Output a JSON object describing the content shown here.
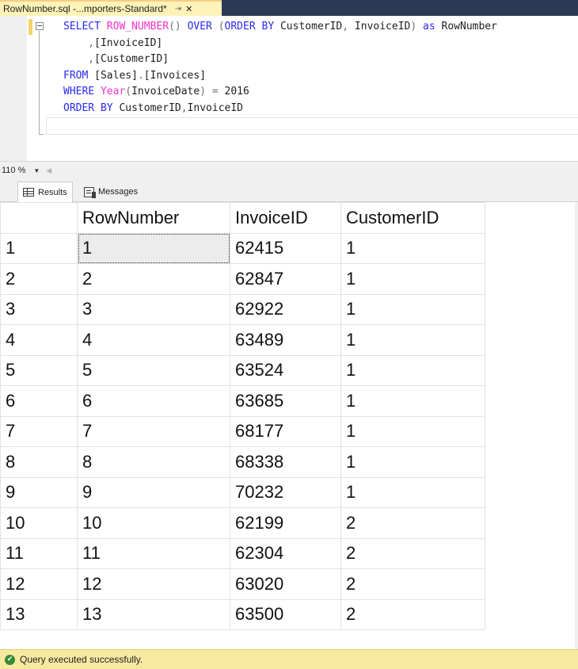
{
  "document_tab": {
    "title": "RowNumber.sql -...mporters-Standard*",
    "pin_icon": "pin-icon",
    "close_icon": "close-icon"
  },
  "editor": {
    "lines": [
      [
        [
          "kw",
          "SELECT "
        ],
        [
          "fn",
          "ROW_NUMBER"
        ],
        [
          "gr",
          "() "
        ],
        [
          "kw",
          "OVER "
        ],
        [
          "gr",
          "("
        ],
        [
          "kw",
          "ORDER BY "
        ],
        [
          "nm",
          "CustomerID"
        ],
        [
          "gr",
          ", "
        ],
        [
          "nm",
          "InvoiceID"
        ],
        [
          "gr",
          ") "
        ],
        [
          "kw",
          "as "
        ],
        [
          "nm",
          "RowNumber"
        ]
      ],
      [
        [
          "gr",
          "    ,"
        ],
        [
          "nm",
          "[InvoiceID]"
        ]
      ],
      [
        [
          "gr",
          "    ,"
        ],
        [
          "nm",
          "[CustomerID]"
        ]
      ],
      [
        [
          "kw",
          "FROM "
        ],
        [
          "nm",
          "[Sales]"
        ],
        [
          "gr",
          "."
        ],
        [
          "nm",
          "[Invoices]"
        ]
      ],
      [
        [
          "kw",
          "WHERE "
        ],
        [
          "fn",
          "Year"
        ],
        [
          "gr",
          "("
        ],
        [
          "nm",
          "InvoiceDate"
        ],
        [
          "gr",
          ") = "
        ],
        [
          "nm",
          "2016"
        ]
      ],
      [
        [
          "kw",
          "ORDER BY "
        ],
        [
          "nm",
          "CustomerID"
        ],
        [
          "gr",
          ","
        ],
        [
          "nm",
          "InvoiceID"
        ]
      ]
    ]
  },
  "zoom": {
    "value": "110 %"
  },
  "results_tabs": [
    {
      "label": "Results",
      "icon": "grid-icon",
      "active": true
    },
    {
      "label": "Messages",
      "icon": "messages-icon",
      "active": false
    }
  ],
  "results": {
    "columns": [
      "",
      "RowNumber",
      "InvoiceID",
      "CustomerID"
    ],
    "rows": [
      [
        "1",
        "1",
        "62415",
        "1"
      ],
      [
        "2",
        "2",
        "62847",
        "1"
      ],
      [
        "3",
        "3",
        "62922",
        "1"
      ],
      [
        "4",
        "4",
        "63489",
        "1"
      ],
      [
        "5",
        "5",
        "63524",
        "1"
      ],
      [
        "6",
        "6",
        "63685",
        "1"
      ],
      [
        "7",
        "7",
        "68177",
        "1"
      ],
      [
        "8",
        "8",
        "68338",
        "1"
      ],
      [
        "9",
        "9",
        "70232",
        "1"
      ],
      [
        "10",
        "10",
        "62199",
        "2"
      ],
      [
        "11",
        "11",
        "62304",
        "2"
      ],
      [
        "12",
        "12",
        "63020",
        "2"
      ],
      [
        "13",
        "13",
        "63500",
        "2"
      ]
    ]
  },
  "status": {
    "text": "Query executed successfully.",
    "icon": "success-check-icon",
    "color": "#f8e9a1"
  }
}
